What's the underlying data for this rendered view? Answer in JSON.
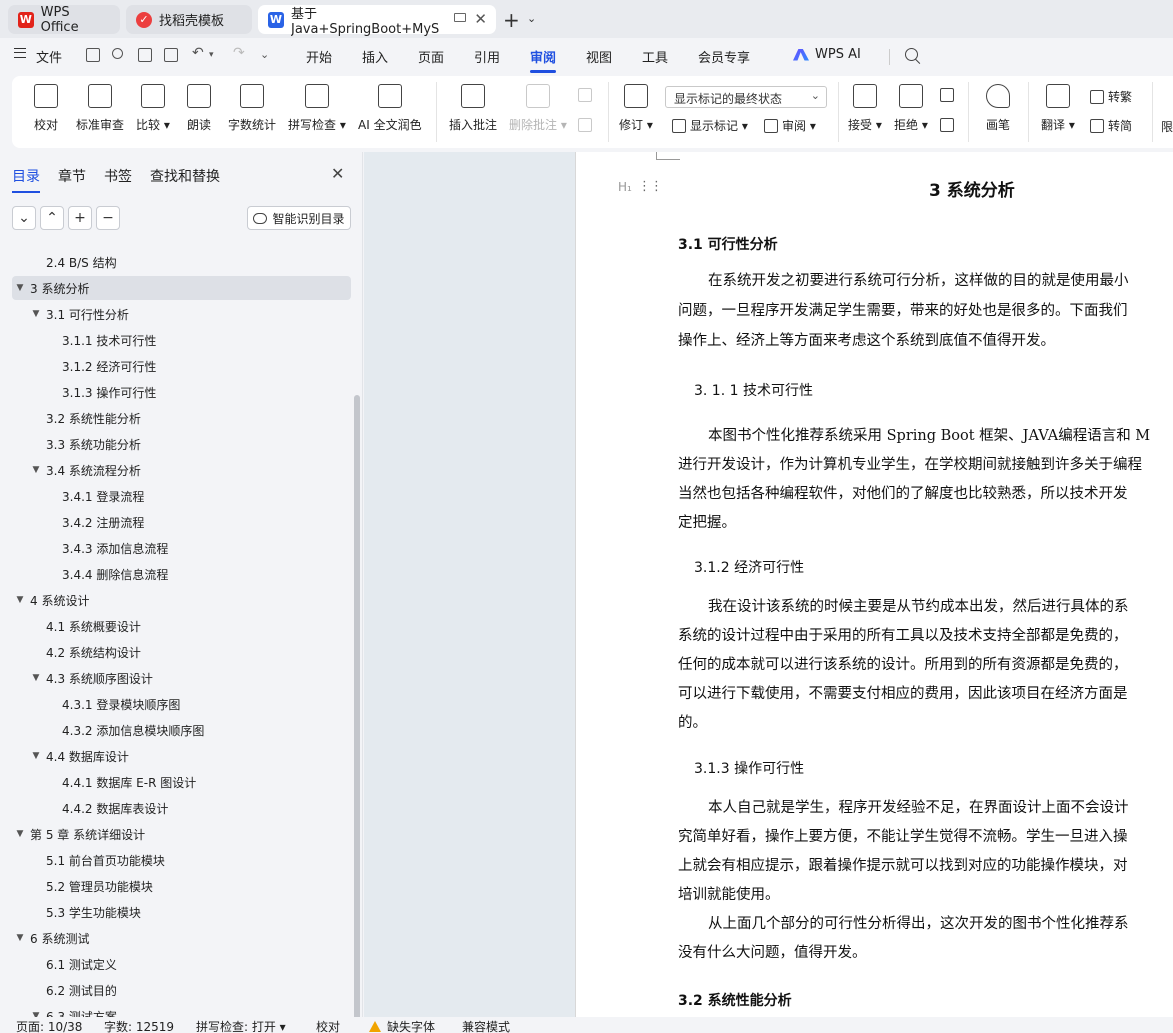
{
  "tabs": [
    {
      "label": "WPS Office",
      "icon": "wps-logo-icon"
    },
    {
      "label": "找稻壳模板",
      "icon": "docer-logo-icon"
    },
    {
      "label": "基于Java+SpringBoot+MyS",
      "icon": "word-doc-icon"
    }
  ],
  "menu": {
    "file": "文件",
    "tabs": [
      "开始",
      "插入",
      "页面",
      "引用",
      "审阅",
      "视图",
      "工具",
      "会员专享"
    ],
    "active_tab": "审阅",
    "ai": "WPS AI"
  },
  "ribbon": {
    "proofread": "校对",
    "standard_review": "标准审查",
    "compare": "比较",
    "read_aloud": "朗读",
    "word_count": "字数统计",
    "spell_check": "拼写检查",
    "ai_polish": "AI 全文润色",
    "insert_comment": "插入批注",
    "delete_comment": "删除批注",
    "track_changes": "修订",
    "markup_dropdown": "显示标记的最终状态",
    "show_markup": "显示标记",
    "review": "审阅",
    "accept": "接受",
    "reject": "拒绝",
    "pen": "画笔",
    "translate": "翻译",
    "to_traditional": "转繁",
    "to_simplified": "转简",
    "limit": "限"
  },
  "panel": {
    "tabs": [
      "目录",
      "章节",
      "书签",
      "查找和替换"
    ],
    "smart_toc": "智能识别目录"
  },
  "toc": [
    {
      "label": "2.4 B/S 结构",
      "level": 2,
      "arrow": ""
    },
    {
      "label": "3  系统分析",
      "level": 1,
      "arrow": "▼"
    },
    {
      "label": "3.1  可行性分析",
      "level": 2,
      "arrow": "▼"
    },
    {
      "label": "3.1.1  技术可行性",
      "level": 3,
      "arrow": ""
    },
    {
      "label": "3.1.2 经济可行性",
      "level": 3,
      "arrow": ""
    },
    {
      "label": "3.1.3 操作可行性",
      "level": 3,
      "arrow": ""
    },
    {
      "label": "3.2  系统性能分析",
      "level": 2,
      "arrow": ""
    },
    {
      "label": "3.3  系统功能分析",
      "level": 2,
      "arrow": ""
    },
    {
      "label": "3.4 系统流程分析",
      "level": 2,
      "arrow": "▼"
    },
    {
      "label": "3.4.1 登录流程",
      "level": 3,
      "arrow": ""
    },
    {
      "label": "3.4.2 注册流程",
      "level": 3,
      "arrow": ""
    },
    {
      "label": "3.4.3 添加信息流程",
      "level": 3,
      "arrow": ""
    },
    {
      "label": "3.4.4 删除信息流程",
      "level": 3,
      "arrow": ""
    },
    {
      "label": "4   系统设计",
      "level": 1,
      "arrow": "▼"
    },
    {
      "label": "4.1 系统概要设计",
      "level": 2,
      "arrow": ""
    },
    {
      "label": "4.2 系统结构设计",
      "level": 2,
      "arrow": ""
    },
    {
      "label": "4.3 系统顺序图设计",
      "level": 2,
      "arrow": "▼"
    },
    {
      "label": "4.3.1 登录模块顺序图",
      "level": 3,
      "arrow": ""
    },
    {
      "label": "4.3.2 添加信息模块顺序图",
      "level": 3,
      "arrow": ""
    },
    {
      "label": "4.4 数据库设计",
      "level": 2,
      "arrow": "▼"
    },
    {
      "label": "4.4.1 数据库 E-R 图设计",
      "level": 3,
      "arrow": ""
    },
    {
      "label": "4.4.2 数据库表设计",
      "level": 3,
      "arrow": ""
    },
    {
      "label": "第 5 章  系统详细设计",
      "level": 1,
      "arrow": "▼"
    },
    {
      "label": "5.1 前台首页功能模块",
      "level": 2,
      "arrow": ""
    },
    {
      "label": "5.2 管理员功能模块",
      "level": 2,
      "arrow": ""
    },
    {
      "label": "5.3 学生功能模块",
      "level": 2,
      "arrow": ""
    },
    {
      "label": "6  系统测试",
      "level": 1,
      "arrow": "▼"
    },
    {
      "label": "6.1  测试定义",
      "level": 2,
      "arrow": ""
    },
    {
      "label": "6.2  测试目的",
      "level": 2,
      "arrow": ""
    },
    {
      "label": "6.3 测试方案",
      "level": 2,
      "arrow": "▼"
    }
  ],
  "document": {
    "heading_marker": "H₁",
    "chapter_title": "3  系统分析",
    "sec_3_1": "3.1  可行性分析",
    "p1": [
      "在系统开发之初要进行系统可行分析，这样做的目的就是使用最小",
      "问题，一旦程序开发满足学生需要，带来的好处也是很多的。下面我们",
      "操作上、经济上等方面来考虑这个系统到底值不值得开发。"
    ],
    "sec_3_1_1": "3. 1. 1  技术可行性",
    "p2": [
      "本图书个性化推荐系统采用 Spring Boot 框架、JAVA编程语言和 M",
      "进行开发设计，作为计算机专业学生，在学校期间就接触到许多关于编程",
      "当然也包括各种编程软件，对他们的了解度也比较熟悉，所以技术开发",
      "定把握。"
    ],
    "sec_3_1_2": "3.1.2 经济可行性",
    "p3": [
      "我在设计该系统的时候主要是从节约成本出发，然后进行具体的系",
      "系统的设计过程中由于采用的所有工具以及技术支持全部都是免费的，",
      "任何的成本就可以进行该系统的设计。所用到的所有资源都是免费的，",
      "可以进行下载使用，不需要支付相应的费用，因此该项目在经济方面是",
      "的。"
    ],
    "sec_3_1_3": "3.1.3 操作可行性",
    "p4": [
      "本人自己就是学生，程序开发经验不足，在界面设计上面不会设计",
      "究简单好看，操作上要方便，不能让学生觉得不流畅。学生一旦进入操",
      "上就会有相应提示，跟着操作提示就可以找到对应的功能操作模块，对",
      "培训就能使用。"
    ],
    "p5": [
      "从上面几个部分的可行性分析得出，这次开发的图书个性化推荐系",
      "没有什么大问题，值得开发。"
    ],
    "sec_3_2": "3.2  系统性能分析"
  },
  "status": {
    "page": "页面: 10/38",
    "words": "字数: 12519",
    "spell": "拼写检查: 打开",
    "proof": "校对",
    "missing_font": "缺失字体",
    "compat": "兼容模式"
  }
}
